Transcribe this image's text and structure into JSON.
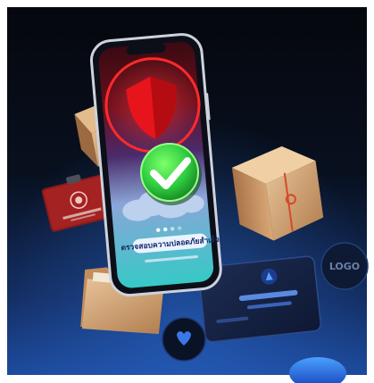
{
  "image": {
    "subject": "smartphone-security-illustration",
    "frame_color": "#ffffff",
    "background_colors": [
      "#05070d",
      "#0b1630",
      "#1d4a9c"
    ]
  },
  "phone": {
    "screen_caption": "ตรวจสอบความปลอดภัยสำเร็จ",
    "accent_colors": {
      "shield": "#e8141c",
      "ring": "#ff2a2a",
      "check": "#2ecc40",
      "screen_top": "#6a0f1d",
      "screen_bottom": "#36c9c6"
    }
  },
  "floating_objects": {
    "card_bottom_right_text": "LOGO",
    "items": [
      "parcel-box-left",
      "parcel-box-right",
      "folder",
      "red-id-card",
      "dark-credit-card",
      "round-badge-bottom",
      "round-badge-right",
      "blue-orb"
    ]
  }
}
